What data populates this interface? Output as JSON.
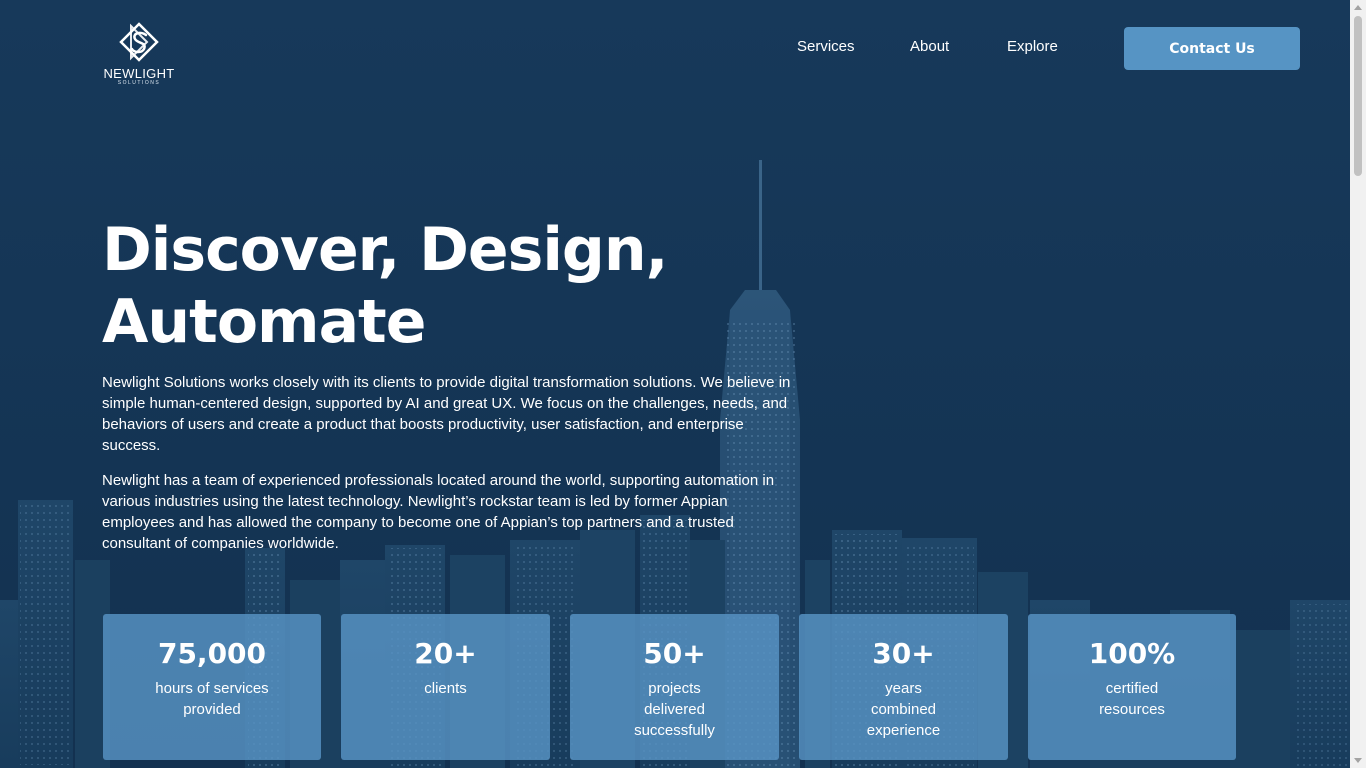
{
  "brand": {
    "name": "NEWLIGHT",
    "subtitle": "SOLUTIONS",
    "logo_icon": "newlight-s-diamond-logo"
  },
  "nav": {
    "items": [
      {
        "label": "Services"
      },
      {
        "label": "About"
      },
      {
        "label": "Explore"
      }
    ],
    "contact_label": "Contact Us"
  },
  "hero": {
    "headline": "Discover, Design, Automate",
    "paragraph1": "Newlight Solutions works closely with its clients to provide digital transformation solutions. We believe in simple human-centered design, supported by AI and great UX. We focus on the challenges, needs, and behaviors of users and create a product that boosts productivity, user satisfaction, and enterprise success.",
    "paragraph2": "Newlight has a team of experienced professionals located around the world, supporting automation in various industries using the latest technology. Newlight’s rockstar team is led by former Appian employees and has allowed the company to become one of Appian’s top partners and a trusted consultant of companies worldwide."
  },
  "stats": [
    {
      "value": "75,000",
      "label": "hours of services provided"
    },
    {
      "value": "20+",
      "label": "clients"
    },
    {
      "value": "50+",
      "label": "projects delivered successfully"
    },
    {
      "value": "30+",
      "label": "years combined experience"
    },
    {
      "value": "100%",
      "label": "certified resources"
    }
  ],
  "colors": {
    "background": "#143552",
    "accent": "#5694c4",
    "card": "#5894c4",
    "text": "#ffffff"
  }
}
